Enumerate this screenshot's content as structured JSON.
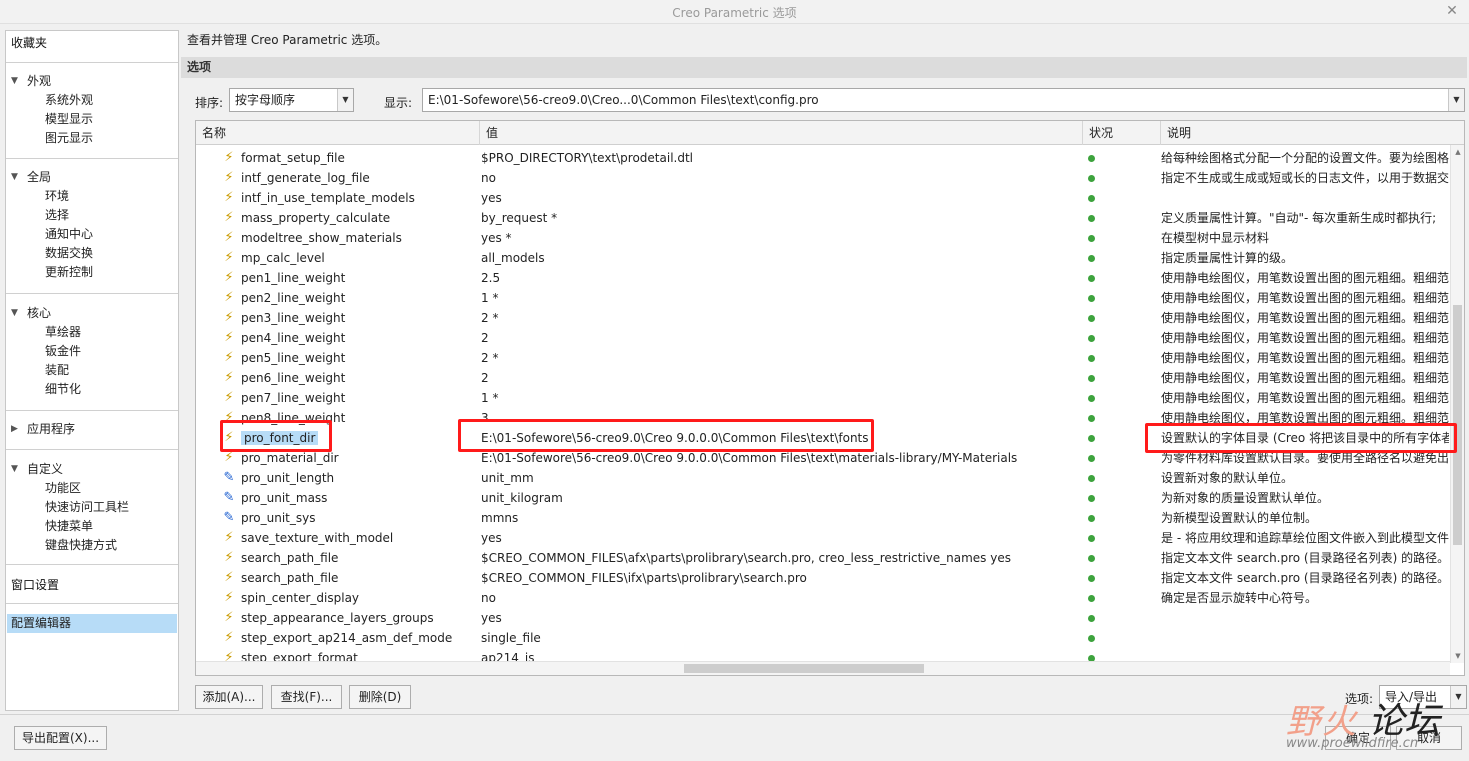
{
  "window": {
    "title": "Creo Parametric 选项"
  },
  "sidebar": {
    "favorites": "收藏夹",
    "groups": [
      {
        "label": "外观",
        "items": [
          "系统外观",
          "模型显示",
          "图元显示"
        ]
      },
      {
        "label": "全局",
        "items": [
          "环境",
          "选择",
          "通知中心",
          "数据交换",
          "更新控制"
        ]
      },
      {
        "label": "核心",
        "items": [
          "草绘器",
          "钣金件",
          "装配",
          "细节化"
        ]
      },
      {
        "label": "应用程序",
        "items": []
      },
      {
        "label": "自定义",
        "items": [
          "功能区",
          "快速访问工具栏",
          "快捷菜单",
          "键盘快捷方式"
        ]
      }
    ],
    "window_settings": "窗口设置",
    "config_editor": "配置编辑器"
  },
  "main": {
    "description": "查看并管理 Creo Parametric 选项。",
    "section": "选项",
    "sort_label": "排序:",
    "sort_value": "按字母顺序",
    "show_label": "显示:",
    "show_value": "E:\\01-Sofewore\\56-creo9.0\\Creo...0\\Common Files\\text\\config.pro"
  },
  "table": {
    "columns": [
      "名称",
      "值",
      "状况",
      "说明"
    ],
    "rows": [
      {
        "icon": "bolt",
        "name": "format_setup_file",
        "value": "$PRO_DIRECTORY\\text\\prodetail.dtl",
        "desc": "给每种绘图格式分配一个分配的设置文件。要为绘图格"
      },
      {
        "icon": "bolt",
        "name": "intf_generate_log_file",
        "value": "no",
        "desc": "指定不生成或生成或短或长的日志文件，以用于数据交"
      },
      {
        "icon": "bolt",
        "name": "intf_in_use_template_models",
        "value": "yes",
        "desc": ""
      },
      {
        "icon": "bolt",
        "name": "mass_property_calculate",
        "value": "by_request *",
        "desc": "定义质量属性计算。\"自动\"- 每次重新生成时都执行;"
      },
      {
        "icon": "bolt",
        "name": "modeltree_show_materials",
        "value": "yes *",
        "desc": "在模型树中显示材料"
      },
      {
        "icon": "bolt",
        "name": "mp_calc_level",
        "value": "all_models",
        "desc": "指定质量属性计算的级。"
      },
      {
        "icon": "bolt",
        "name": "pen1_line_weight",
        "value": "2.5",
        "desc": "使用静电绘图仪，用笔数设置出图的图元粗细。粗细范"
      },
      {
        "icon": "bolt",
        "name": "pen2_line_weight",
        "value": "1 *",
        "desc": "使用静电绘图仪，用笔数设置出图的图元粗细。粗细范"
      },
      {
        "icon": "bolt",
        "name": "pen3_line_weight",
        "value": "2 *",
        "desc": "使用静电绘图仪，用笔数设置出图的图元粗细。粗细范"
      },
      {
        "icon": "bolt",
        "name": "pen4_line_weight",
        "value": "2",
        "desc": "使用静电绘图仪，用笔数设置出图的图元粗细。粗细范"
      },
      {
        "icon": "bolt",
        "name": "pen5_line_weight",
        "value": "2 *",
        "desc": "使用静电绘图仪，用笔数设置出图的图元粗细。粗细范"
      },
      {
        "icon": "bolt",
        "name": "pen6_line_weight",
        "value": "2",
        "desc": "使用静电绘图仪，用笔数设置出图的图元粗细。粗细范"
      },
      {
        "icon": "bolt",
        "name": "pen7_line_weight",
        "value": "1 *",
        "desc": "使用静电绘图仪，用笔数设置出图的图元粗细。粗细范"
      },
      {
        "icon": "bolt",
        "name": "pen8_line_weight",
        "value": "3",
        "desc": "使用静电绘图仪，用笔数设置出图的图元粗细。粗细范"
      },
      {
        "icon": "bolt",
        "name": "pro_font_dir",
        "value": "E:\\01-Sofewore\\56-creo9.0\\Creo 9.0.0.0\\Common Files\\text\\fonts",
        "desc": "设置默认的字体目录 (Creo 将把该目录中的所有字体者"
      },
      {
        "icon": "bolt",
        "name": "pro_material_dir",
        "value": "E:\\01-Sofewore\\56-creo9.0\\Creo 9.0.0.0\\Common Files\\text\\materials-library/MY-Materials",
        "desc": "为零件材料库设置默认目录。要使用全路径名以避免出"
      },
      {
        "icon": "edit",
        "name": "pro_unit_length",
        "value": "unit_mm",
        "desc": "设置新对象的默认单位。"
      },
      {
        "icon": "edit",
        "name": "pro_unit_mass",
        "value": "unit_kilogram",
        "desc": "为新对象的质量设置默认单位。"
      },
      {
        "icon": "edit",
        "name": "pro_unit_sys",
        "value": "mmns",
        "desc": "为新模型设置默认的单位制。"
      },
      {
        "icon": "bolt",
        "name": "save_texture_with_model",
        "value": "yes",
        "desc": "是 - 将应用纹理和追踪草绘位图文件嵌入到此模型文件"
      },
      {
        "icon": "bolt",
        "name": "search_path_file",
        "value": "$CREO_COMMON_FILES\\afx\\parts\\prolibrary\\search.pro, creo_less_restrictive_names yes",
        "desc": "指定文本文件 search.pro (目录路径名列表) 的路径。"
      },
      {
        "icon": "bolt",
        "name": "search_path_file",
        "value": "$CREO_COMMON_FILES\\ifx\\parts\\prolibrary\\search.pro",
        "desc": "指定文本文件 search.pro (目录路径名列表) 的路径。"
      },
      {
        "icon": "bolt",
        "name": "spin_center_display",
        "value": "no",
        "desc": "确定是否显示旋转中心符号。"
      },
      {
        "icon": "bolt",
        "name": "step_appearance_layers_groups",
        "value": "yes",
        "desc": ""
      },
      {
        "icon": "bolt",
        "name": "step_export_ap214_asm_def_mode",
        "value": "single_file",
        "desc": ""
      },
      {
        "icon": "bolt",
        "name": "step_export_format",
        "value": "ap214_is",
        "desc": ""
      }
    ]
  },
  "buttons": {
    "add": "添加(A)...",
    "find": "查找(F)...",
    "delete": "删除(D)",
    "options_label": "选项:",
    "import_export": "导入/导出",
    "export_config": "导出配置(X)...",
    "ok": "确定",
    "cancel": "取消"
  },
  "watermark": {
    "text1": "野火",
    "text2": "论坛",
    "url": "www.proewildfire.cn"
  },
  "colors": {
    "selection": "#b7dcf7",
    "highlight_box": "#ff1a1a",
    "status_ok": "#3da33d"
  }
}
